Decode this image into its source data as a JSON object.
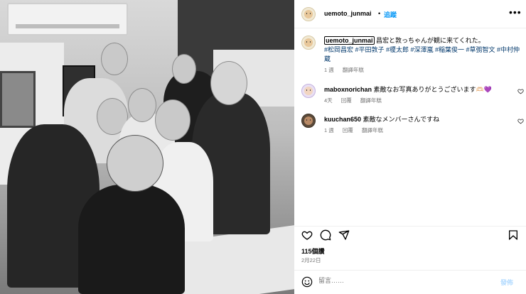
{
  "post": {
    "username": "uemoto_junmai",
    "separator": "•",
    "follow_label": "追蹤",
    "more_label": "•••",
    "caption": {
      "username": "uemoto_junmai",
      "text": "昌宏と敦っちゃんが観に来てくれた。",
      "hashtags": "#松岡昌宏 #平田敦子 #榎太郎 #深澤嵐 #稲葉俊一 #草彅智文 #中村仲蔵",
      "time": "1 週",
      "translate_label": "翻譯年糕"
    },
    "comments": [
      {
        "username": "maboxnorichan",
        "text": "素敵なお写真ありがとうございます🫶🏻💜",
        "time": "4天",
        "reply_label": "回覆",
        "translate_label": "翻譯年糕"
      },
      {
        "username": "kuuchan650",
        "text": "素敵なメンバーさんですね",
        "time": "1 週",
        "reply_label": "回覆",
        "translate_label": "翻譯年糕"
      }
    ],
    "likes": "115個讚",
    "date": "2月22日",
    "comment_placeholder": "留言……",
    "post_label": "發佈"
  },
  "colors": {
    "link_blue": "#0095f6",
    "hashtag_blue": "#00376b",
    "muted_gray": "#737373",
    "disabled_post": "#b3dbff"
  },
  "icons": [
    "more-icon",
    "heart-icon",
    "comment-icon",
    "share-icon",
    "bookmark-icon",
    "emoji-icon"
  ]
}
